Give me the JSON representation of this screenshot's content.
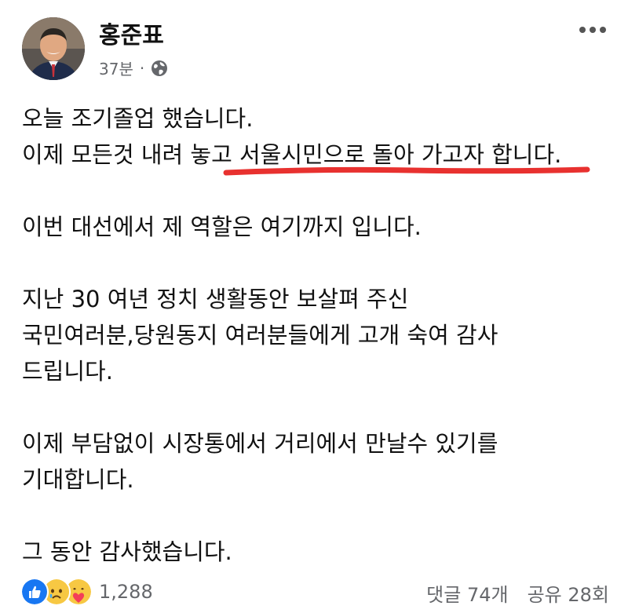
{
  "author": {
    "name": "홍준표",
    "time": "37분",
    "separator": "·",
    "privacy_icon": "globe-icon"
  },
  "post": {
    "lines": [
      "오늘 조기졸업 했습니다.",
      "이제 모든것 내려 놓고 서울시민으로 돌아 가고자 합니다.",
      "",
      "이번 대선에서 제 역할은 여기까지 입니다.",
      "",
      "지난 30 여년 정치 생활동안 보살펴 주신",
      "국민여러분,당원동지 여러분들에게 고개 숙여 감사",
      "드립니다.",
      "",
      "이제 부담없이 시장통에서 거리에서 만날수 있기를",
      "기대합니다.",
      "",
      "그 동안 감사했습니다."
    ],
    "highlight_color": "#e8312f"
  },
  "reactions": {
    "icons": [
      "like-icon",
      "sad-icon",
      "care-icon"
    ],
    "count": "1,288"
  },
  "stats": {
    "comments": "댓글 74개",
    "shares": "공유 28회"
  },
  "colors": {
    "like": "#1877f2",
    "secondary_text": "#65676b"
  }
}
